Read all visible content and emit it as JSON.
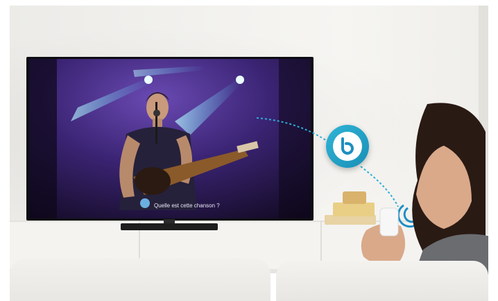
{
  "scene": {
    "tv_caption": "Quelle est cette chanson ?",
    "assistant_icon": "bixby-icon",
    "voice_icon": "voice-wave-icon",
    "colors": {
      "assistant_blue": "#23a6cf",
      "stage_purple": "#4a2a86",
      "spotlight_blue": "#7fe8ff",
      "wall": "#f2f1ee"
    }
  }
}
